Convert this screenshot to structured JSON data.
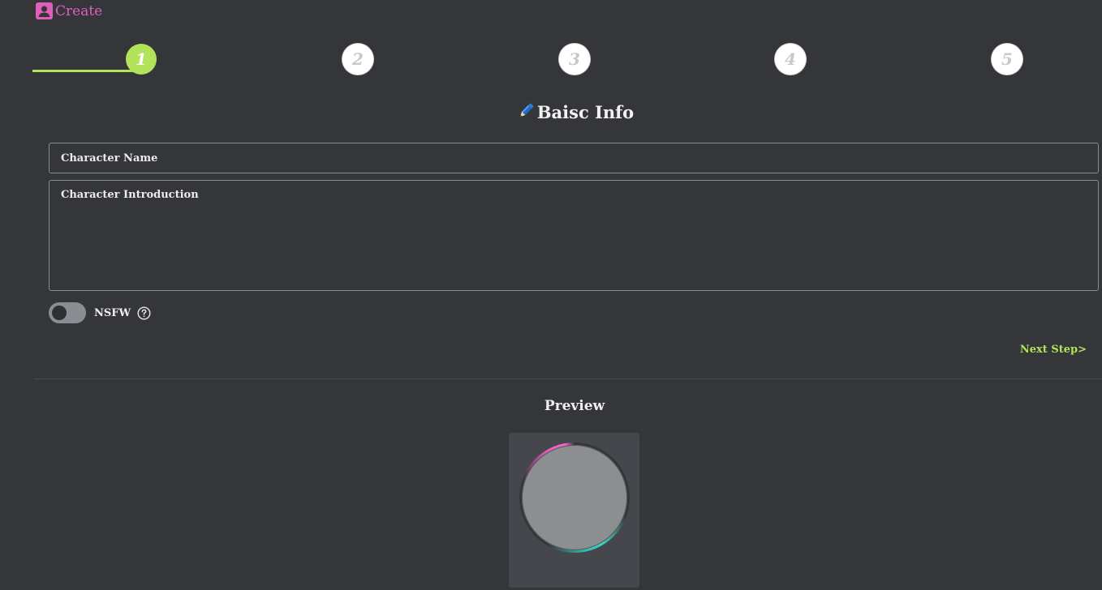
{
  "header": {
    "title": "Create",
    "icon": "user-card-icon",
    "color": "#e15fbb"
  },
  "stepper": {
    "steps": [
      "1",
      "2",
      "3",
      "4",
      "5"
    ],
    "active_index": 0,
    "active_color": "#b2e35a"
  },
  "section": {
    "icon": "pencil-icon",
    "title": "Baisc Info"
  },
  "form": {
    "name_placeholder": "Character Name",
    "intro_placeholder": "Character Introduction",
    "nsfw_label": "NSFW",
    "nsfw_enabled": false,
    "help_icon": "question-circle-icon"
  },
  "actions": {
    "next_step": "Next Step>"
  },
  "preview": {
    "title": "Preview"
  }
}
